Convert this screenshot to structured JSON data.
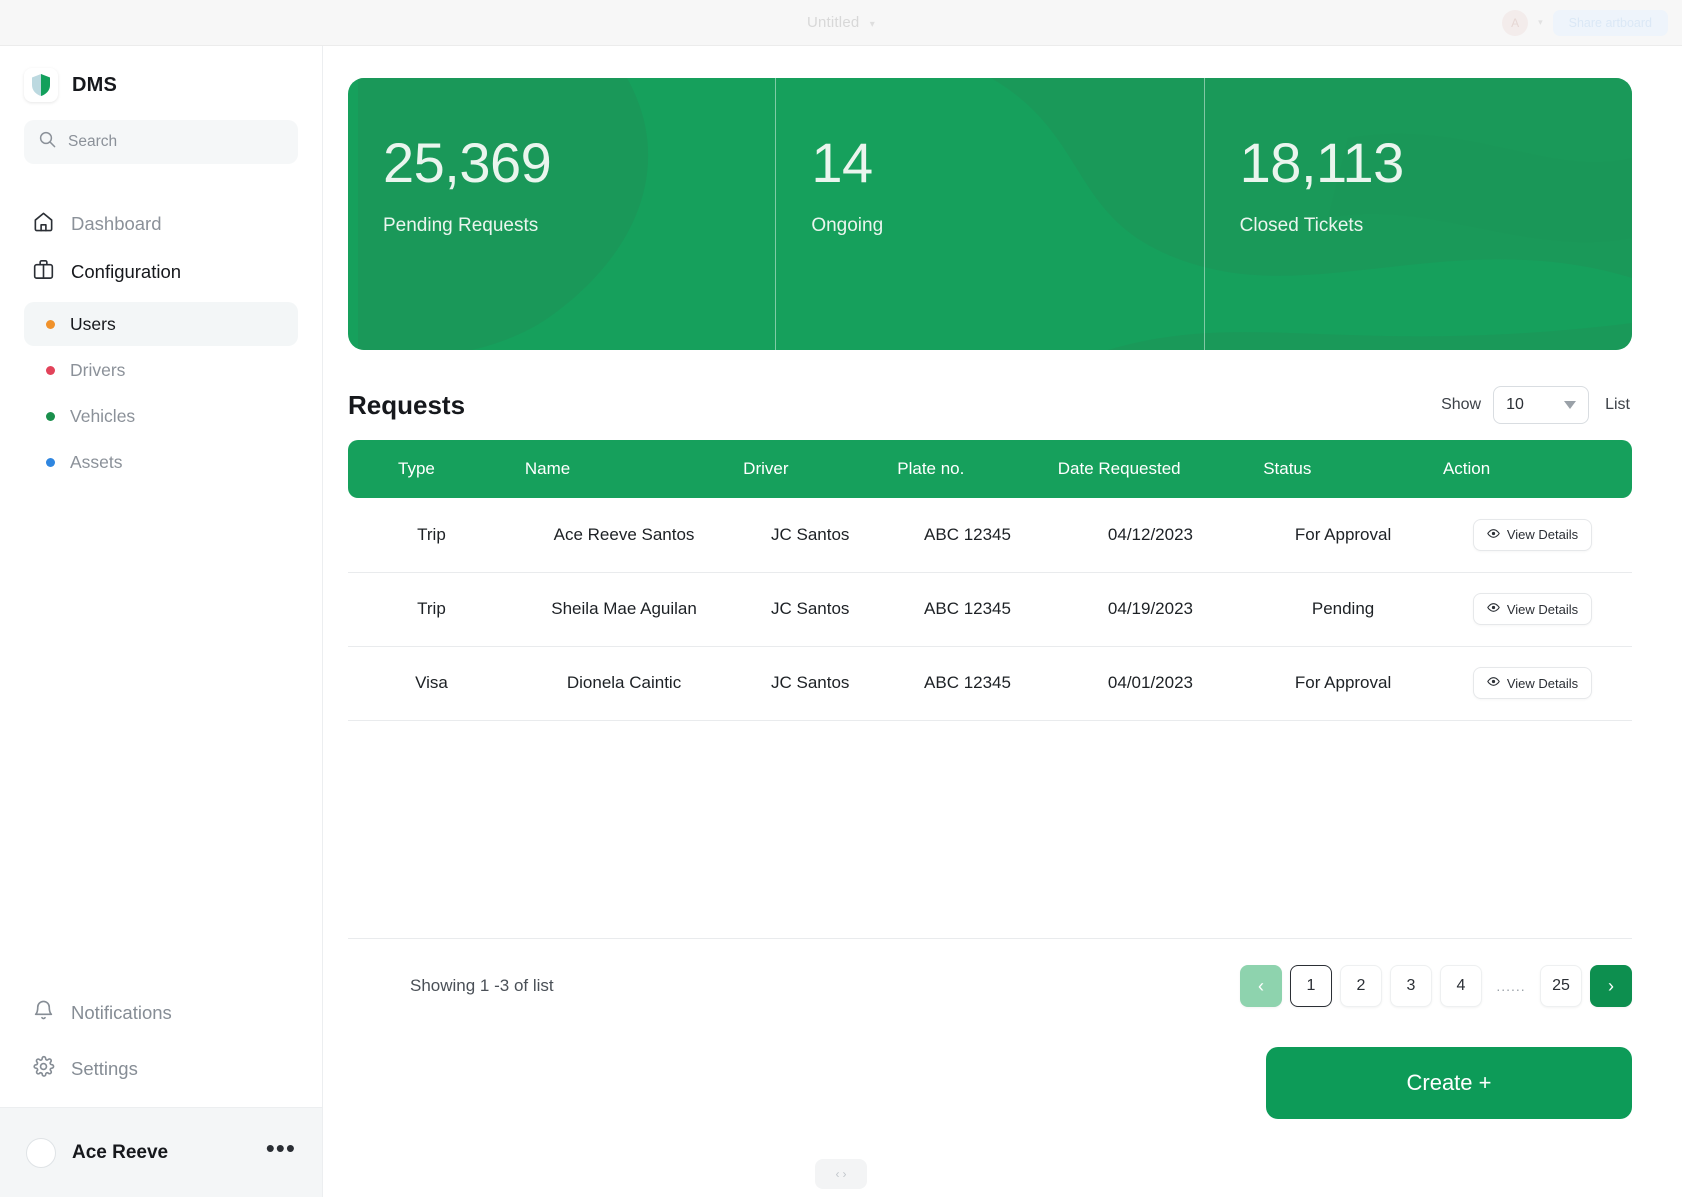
{
  "chrome": {
    "title": "Untitled",
    "caret": "▾",
    "avatar_initial": "A",
    "avatar_caret": "▾",
    "share_label": "Share artboard"
  },
  "sidebar": {
    "brand": {
      "name": "DMS",
      "logo_icon": "shield-icon"
    },
    "search": {
      "placeholder": "Search",
      "icon": "search-icon"
    },
    "nav": [
      {
        "label": "Dashboard",
        "icon": "home-icon",
        "active": false
      },
      {
        "label": "Configuration",
        "icon": "briefcase-icon",
        "active": true
      }
    ],
    "sub_items": [
      {
        "label": "Users",
        "dot_color": "#f0922b",
        "active": true
      },
      {
        "label": "Drivers",
        "dot_color": "#e2435a",
        "active": false
      },
      {
        "label": "Vehicles",
        "dot_color": "#1a8f4c",
        "active": false
      },
      {
        "label": "Assets",
        "dot_color": "#2f86e0",
        "active": false
      }
    ],
    "bottom": [
      {
        "label": "Notifications",
        "icon": "bell-icon"
      },
      {
        "label": "Settings",
        "icon": "gear-icon"
      }
    ],
    "user": {
      "name": "Ace Reeve",
      "menu_icon": "ellipsis-icon",
      "avatar_icon": "avatar-icon"
    }
  },
  "stats": [
    {
      "value": "25,369",
      "label": "Pending Requests"
    },
    {
      "value": "14",
      "label": "Ongoing"
    },
    {
      "value": "18,113",
      "label": "Closed Tickets"
    }
  ],
  "table": {
    "title": "Requests",
    "show_label": "Show",
    "page_size": "10",
    "list_label": "List",
    "columns": [
      "Type",
      "Name",
      "Driver",
      "Plate no.",
      "Date Requested",
      "Status",
      "Action"
    ],
    "rows": [
      {
        "type": "Trip",
        "name": "Ace Reeve Santos",
        "driver": "JC Santos",
        "plate": "ABC 12345",
        "date": "04/12/2023",
        "status": "For Approval",
        "action": "View Details"
      },
      {
        "type": "Trip",
        "name": "Sheila Mae Aguilan",
        "driver": "JC Santos",
        "plate": "ABC 12345",
        "date": "04/19/2023",
        "status": "Pending",
        "action": "View Details"
      },
      {
        "type": "Visa",
        "name": "Dionela Caintic",
        "driver": "JC Santos",
        "plate": "ABC 12345",
        "date": "04/01/2023",
        "status": "For Approval",
        "action": "View Details"
      }
    ],
    "showing": "Showing 1 -3 of list"
  },
  "pagination": {
    "prev_icon": "chevron-left-icon",
    "next_icon": "chevron-right-icon",
    "pages": [
      "1",
      "2",
      "3",
      "4",
      "......",
      "25"
    ],
    "active_page": "1"
  },
  "create_button": {
    "label": "Create +"
  },
  "colors": {
    "brand_green": "#16a05c",
    "button_green": "#0d9b58",
    "pager_next": "#0d8f4f",
    "pager_prev": "#8ed3ae"
  }
}
